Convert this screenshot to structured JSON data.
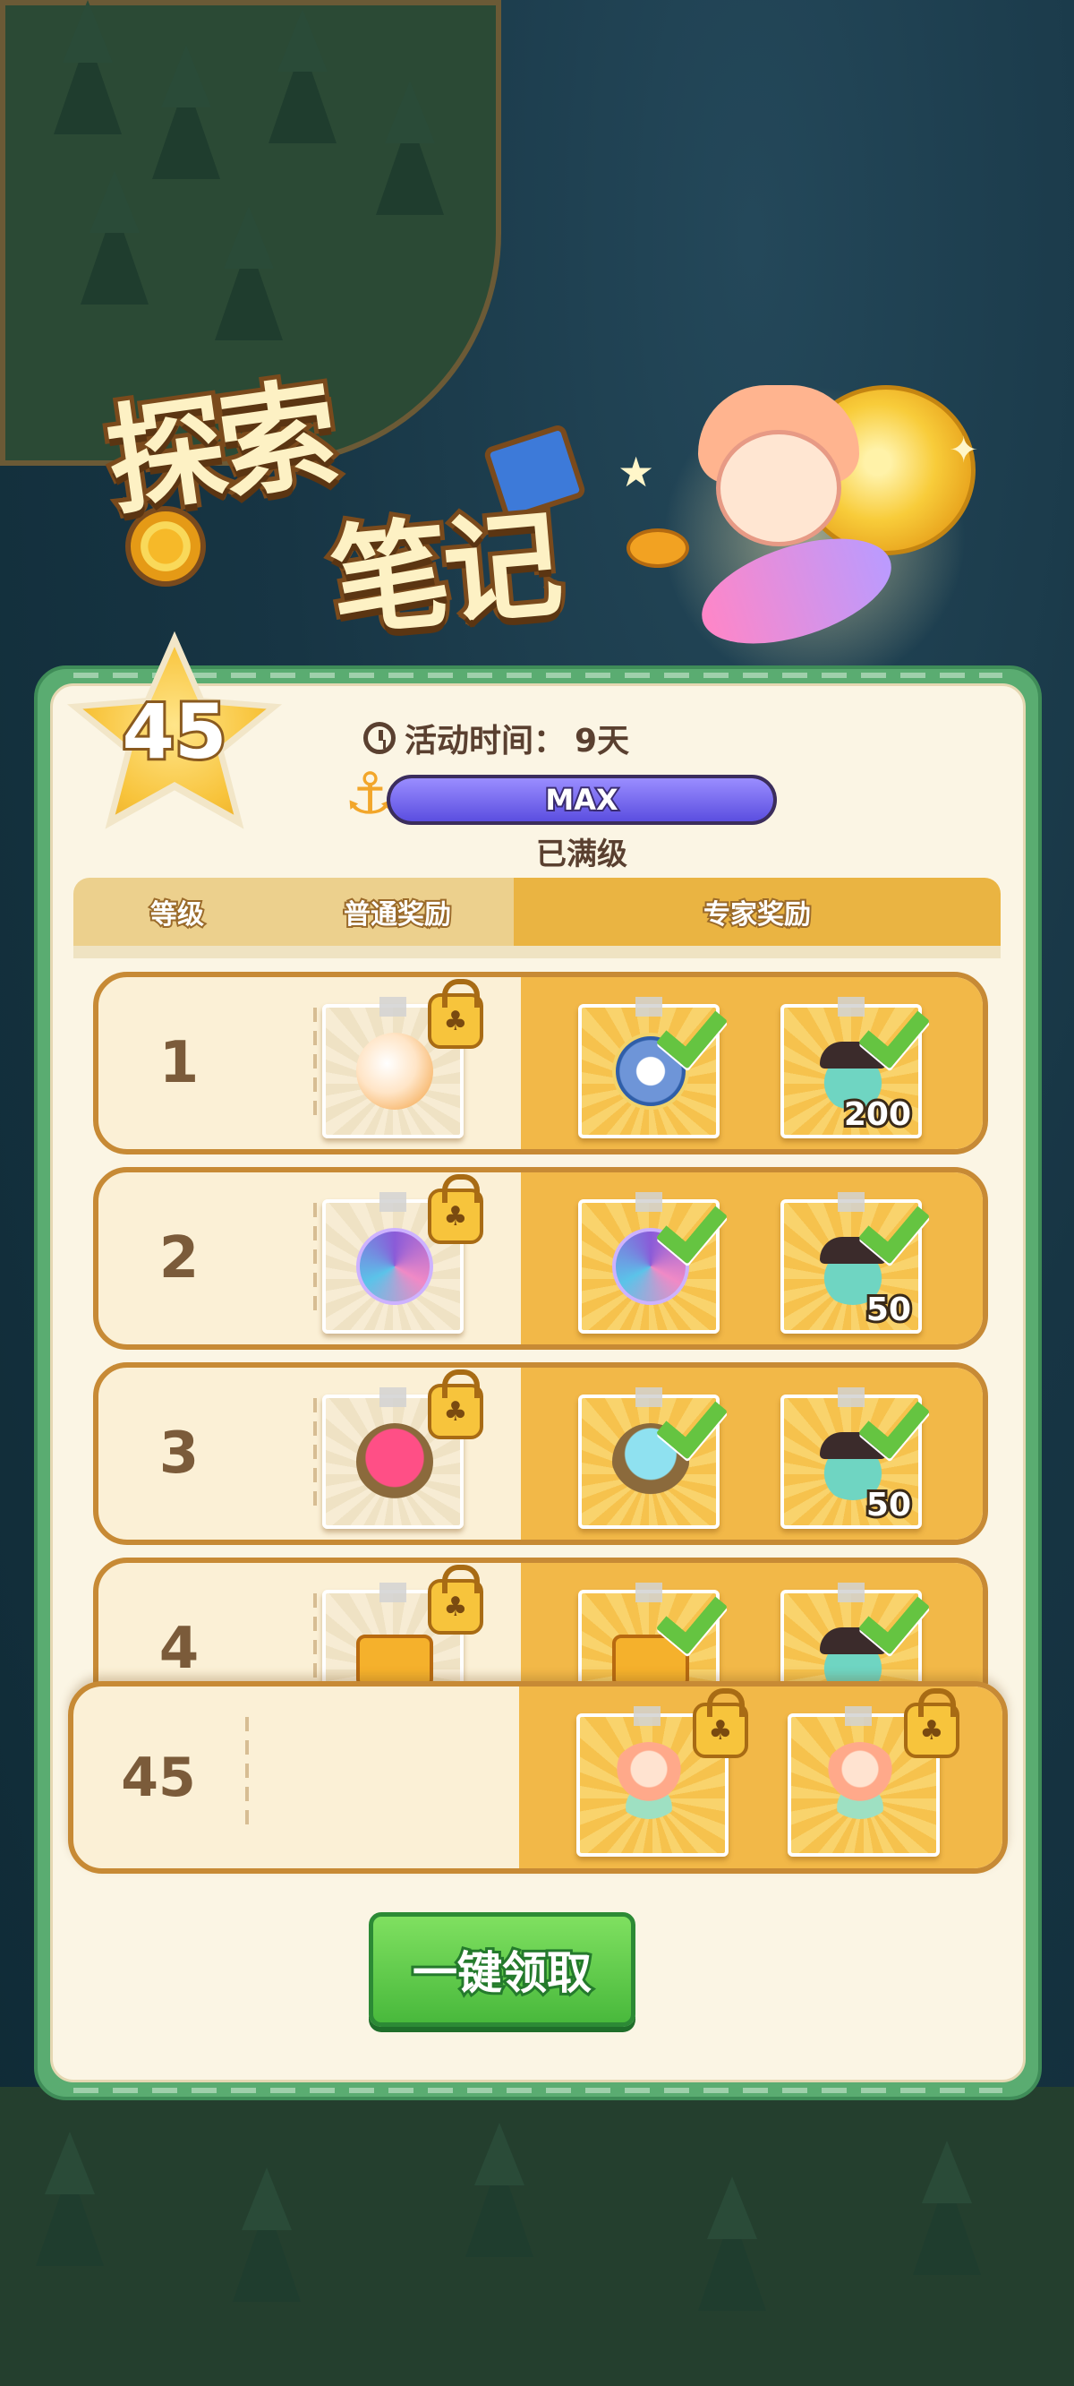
{
  "title": {
    "word1": "探索",
    "word2": "笔记"
  },
  "level": "45",
  "event_time": {
    "label": "活动时间：",
    "value": "9天"
  },
  "progress": {
    "label": "MAX",
    "fill_percent": 100,
    "status": "已满级"
  },
  "table": {
    "headers": {
      "level": "等级",
      "normal": "普通奖励",
      "expert": "专家奖励"
    },
    "rows": [
      {
        "level": "1",
        "normal_icon": "puff-creature-icon",
        "expert": [
          {
            "icon": "cloud-star-badge-icon",
            "qty": ""
          },
          {
            "icon": "pirate-slime-icon",
            "qty": "200"
          }
        ]
      },
      {
        "level": "2",
        "normal_icon": "swirl-orb-icon",
        "expert": [
          {
            "icon": "swirl-orb-icon",
            "qty": ""
          },
          {
            "icon": "pirate-slime-icon",
            "qty": "50"
          }
        ]
      },
      {
        "level": "3",
        "normal_icon": "star-potion-icon",
        "expert": [
          {
            "icon": "star-stone-icon",
            "qty": ""
          },
          {
            "icon": "pirate-slime-icon",
            "qty": "50"
          }
        ]
      },
      {
        "level": "4",
        "normal_icon": "ticket-icon",
        "expert": [
          {
            "icon": "ticket-icon",
            "qty": ""
          },
          {
            "icon": "pirate-slime-icon",
            "qty": ""
          }
        ]
      }
    ],
    "final_row": {
      "level": "45",
      "expert": [
        {
          "icon": "fairy-outfit-icon"
        },
        {
          "icon": "fairy-outfit-icon"
        }
      ]
    }
  },
  "claim_button": "一键领取",
  "colors": {
    "panel_green": "#5aac71",
    "expert_gold": "#f2b848",
    "progress_purple": "#5b4ee0",
    "claim_green": "#49b93c"
  }
}
